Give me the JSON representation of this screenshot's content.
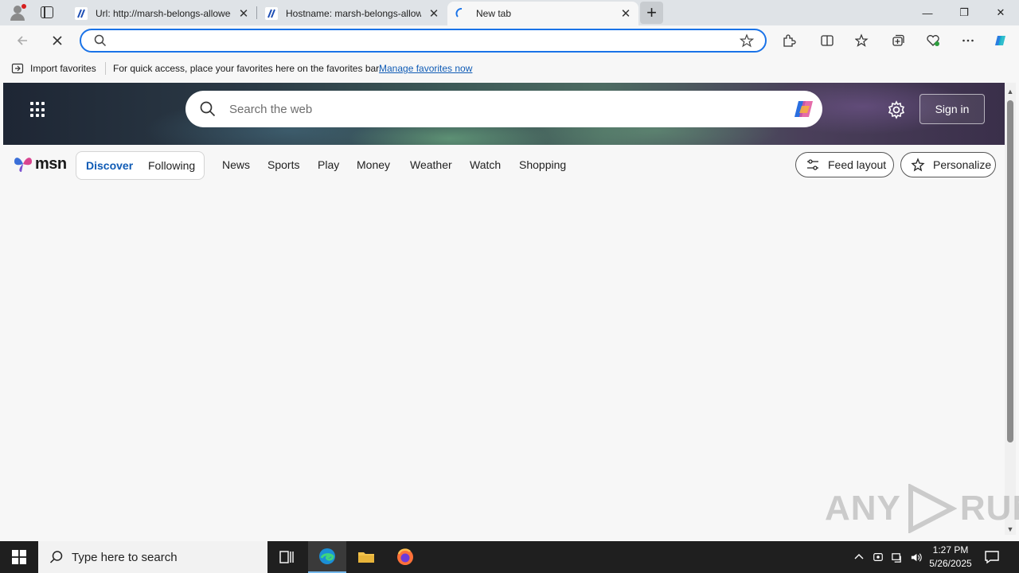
{
  "tabs": [
    {
      "title": "Url: http://marsh-belongs-allowed",
      "close": "✕"
    },
    {
      "title": "Hostname: marsh-belongs-allowed",
      "close": "✕"
    },
    {
      "title": "New tab",
      "close": "✕"
    }
  ],
  "newtab_label": "+",
  "window_controls": {
    "minimize": "—",
    "restore": "❐",
    "close": "✕"
  },
  "omnibox": {
    "value": "",
    "placeholder": ""
  },
  "favorites_bar": {
    "import_label": "Import favorites",
    "message": "For quick access, place your favorites here on the favorites bar.",
    "link": "Manage favorites now"
  },
  "msn": {
    "search_placeholder": "Search the web",
    "sign_in": "Sign in",
    "logo_text": "msn",
    "feed_toggle": {
      "discover": "Discover",
      "following": "Following"
    },
    "nav_links": [
      "News",
      "Sports",
      "Play",
      "Money",
      "Weather",
      "Watch",
      "Shopping"
    ],
    "feed_layout": "Feed layout",
    "personalize": "Personalize"
  },
  "watermark": {
    "left": "ANY",
    "right": "RUN"
  },
  "taskbar": {
    "search_placeholder": "Type here to search",
    "time": "1:27 PM",
    "date": "5/26/2025"
  },
  "colors": {
    "accent": "#1a73e8",
    "link": "#0f5bb5",
    "taskbar": "#1f1f1f",
    "tabstrip": "#dfe3e7"
  }
}
